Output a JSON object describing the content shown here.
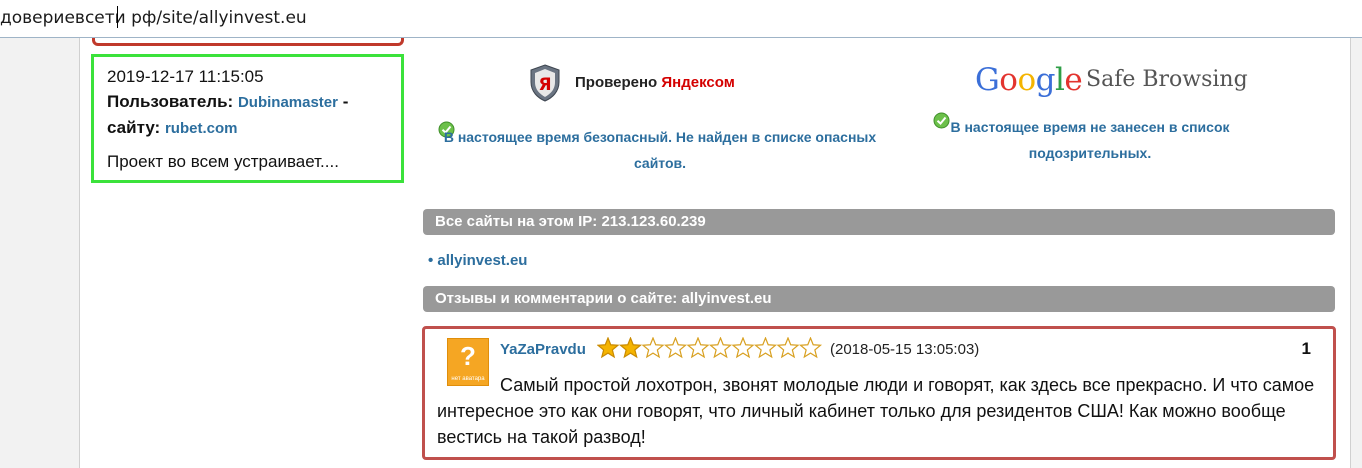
{
  "address_bar": {
    "url": "довериевсети рф/site/allyinvest.eu"
  },
  "left_comment": {
    "datetime": "2019-12-17 11:15:05",
    "user_label": "Пользователь:",
    "user": "Dubinamaster",
    "separator": " -",
    "site_label": "сайту:",
    "site": "rubet.com",
    "text": "Проект во всем устраивает...."
  },
  "yandex": {
    "title_prefix": "Проверено ",
    "title_brand": "Яндексом",
    "status": "В настоящее время безопасный. Не найден в списке опасных сайтов.",
    "logo_letter": "Я"
  },
  "google": {
    "logo_letters": [
      "G",
      "o",
      "o",
      "g",
      "l",
      "e"
    ],
    "logo_colors": [
      "#3b6fd8",
      "#e3342f",
      "#f4b400",
      "#3b6fd8",
      "#2e9e46",
      "#e3342f"
    ],
    "safe_label": "Safe Browsing",
    "status": "В настоящее время не занесен в список подозрительных."
  },
  "ip_section": {
    "header": "Все сайты на этом IP: 213.123.60.239",
    "items": [
      "• allyinvest.eu"
    ]
  },
  "reviews_section": {
    "header": "Отзывы и комментарии о сайте: allyinvest.eu",
    "reviews": [
      {
        "author": "YaZaPravdu",
        "rating": 2,
        "max_rating": 10,
        "date": "(2018-05-15 13:05:03)",
        "number": "1",
        "avatar_symbol": "?",
        "avatar_caption": "нет аватара",
        "text": "Самый простой лохотрон, звонят молодые люди и говорят, как здесь все прекрасно. И что самое интересное это как они говорят, что личный кабинет только для резидентов США! Как можно вообще вестись на такой развод!"
      }
    ]
  },
  "colors": {
    "link": "#2c6e9e",
    "header_gray": "#999999",
    "green_border": "#3be23b",
    "review_border": "#c0504d",
    "star_fill": "#f5b400"
  }
}
